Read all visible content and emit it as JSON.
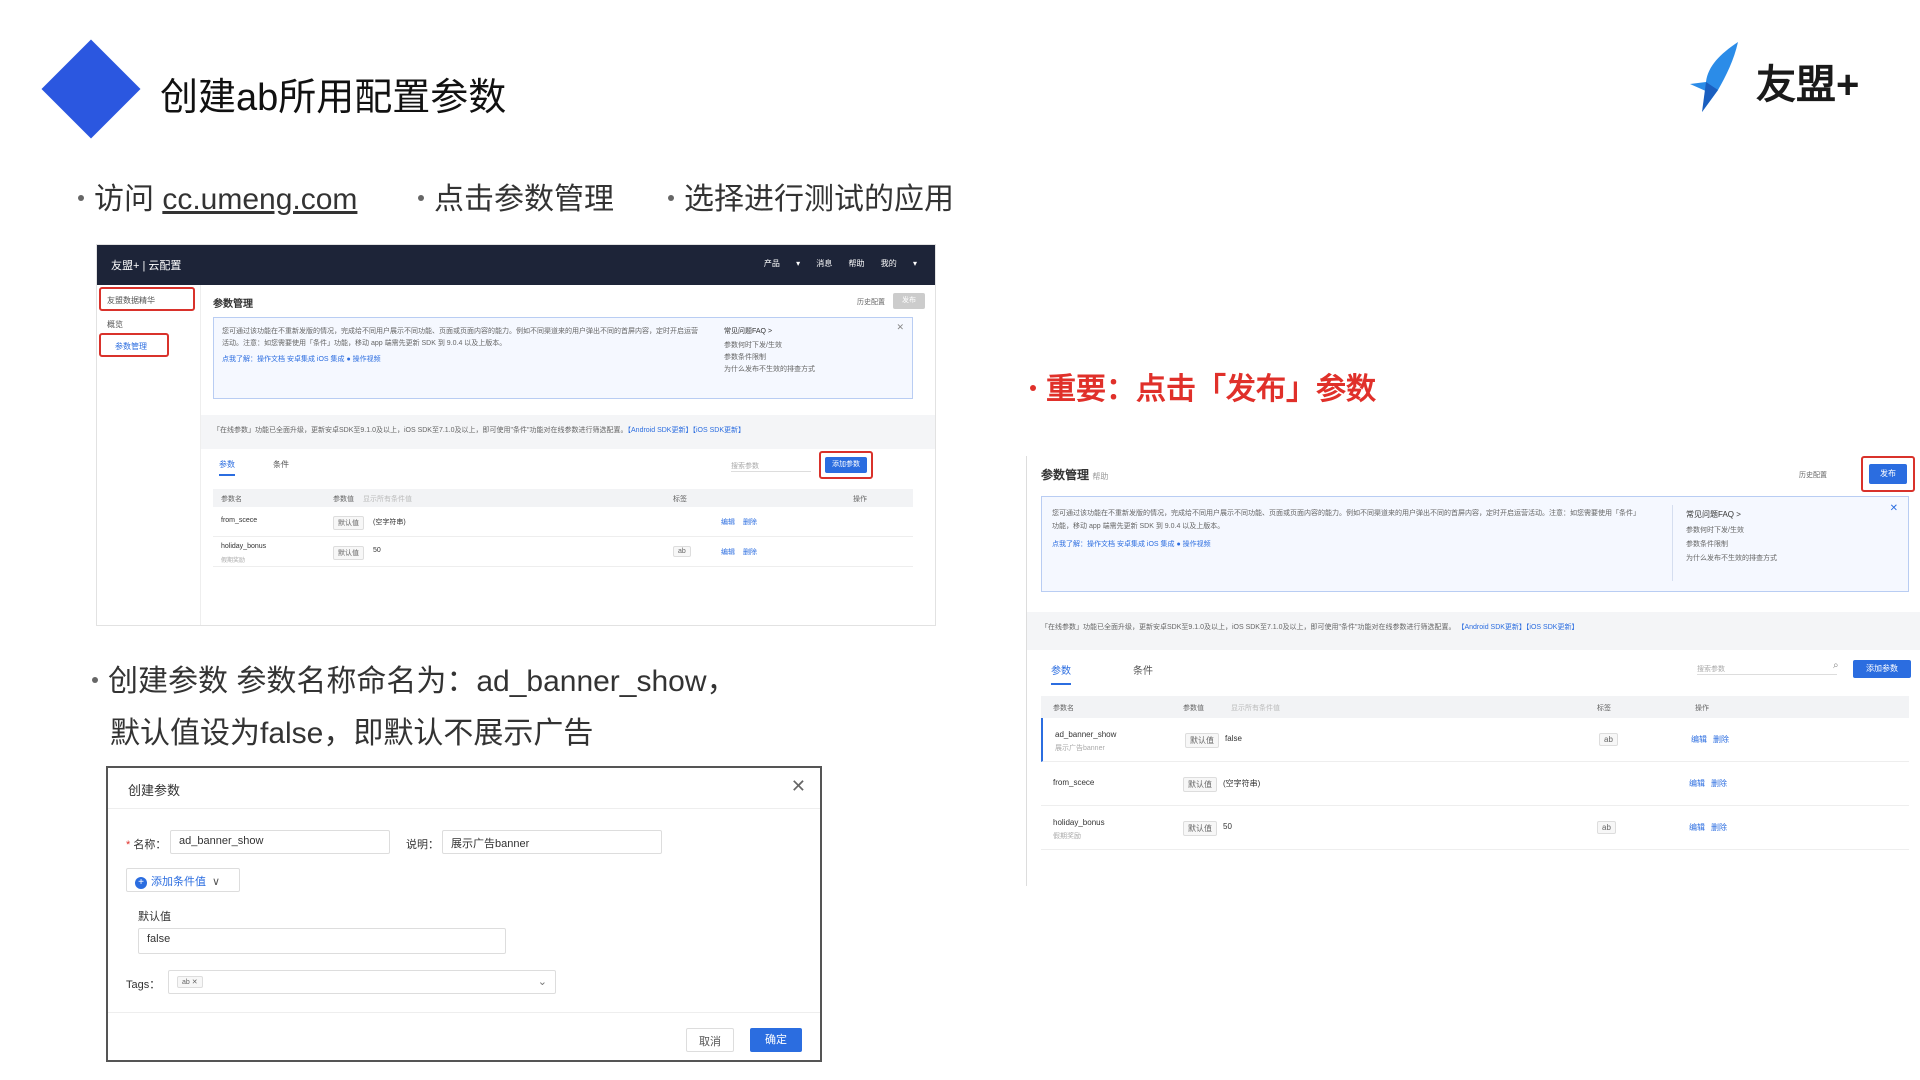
{
  "slide": {
    "title": "创建ab所用配置参数",
    "logo_text": "友盟+",
    "step1_prefix": "访问 ",
    "step1_link": "cc.umeng.com",
    "step2": "点击参数管理",
    "step3": "选择进行测试的应用",
    "important": "重要：点击「发布」参数",
    "create_line1": "创建参数 参数名称命名为：ad_banner_show，",
    "create_line2": "默认值设为false，即默认不展示广告"
  },
  "colors": {
    "accent": "#2b57e0",
    "highlight": "#d9322b",
    "important": "#e0302a",
    "topbar": "#1d2438"
  },
  "console": {
    "brand": "友盟+ | 云配置",
    "nav": "产品 ▾  消息  帮助  我的 ▾",
    "app_selector": "友盟数据精华",
    "sidebar_overview": "概览",
    "sidebar_params": "参数管理",
    "page_title": "参数管理",
    "page_sub": "帮助",
    "history": "历史配置",
    "publish": "发布",
    "info_text1": "您可通过该功能在不重新发版的情况，完成给不同用户展示不同功能、页面或页面内容的能力。例如不同渠道来的用户弹出不同的首屏内容，定时开启",
    "info_text2": "运营活动。注意：如您需要使用「条件」功能，移动 app 端需先更新 SDK 到 9.0.4 以及上版本。",
    "info_links": "点我了解：操作文档  安卓集成  iOS 集成  ● 操作视频",
    "faq_title": "常见问题FAQ >",
    "faq_items": [
      "参数何时下发/生效",
      "参数条件限制",
      "为什么发布不生效的排查方式"
    ],
    "upgrade_note": "「在线参数」功能已全面升级，更新安卓SDK至9.1.0及以上，iOS SDK至7.1.0及以上，即可使用\"条件\"功能对在线参数进行筛选配置。",
    "upgrade_links": "【Android SDK更新】【iOS SDK更新】",
    "tab_params": "参数",
    "tab_conditions": "条件",
    "search_placeholder": "搜索参数",
    "add_param": "添加参数",
    "col_name": "参数名",
    "col_value": "参数值",
    "col_show_all": "显示所有条件值",
    "col_tag": "标签",
    "col_action": "操作",
    "default_label": "默认值",
    "edit": "编辑",
    "delete": "删除",
    "rows1": [
      {
        "name": "from_scece",
        "desc": "",
        "value": "(空字符串)",
        "tag": ""
      },
      {
        "name": "holiday_bonus",
        "desc": "假期奖励",
        "value": "50",
        "tag": "ab"
      }
    ],
    "rows2": [
      {
        "name": "ad_banner_show",
        "desc": "展示广告banner",
        "value": "false",
        "tag": "ab"
      },
      {
        "name": "from_scece",
        "desc": "",
        "value": "(空字符串)",
        "tag": ""
      },
      {
        "name": "holiday_bonus",
        "desc": "假期奖励",
        "value": "50",
        "tag": "ab"
      }
    ]
  },
  "dialog": {
    "title": "创建参数",
    "name_label": "名称：",
    "name_value": "ad_banner_show",
    "desc_label": "说明：",
    "desc_value": "展示广告banner",
    "add_condition": "添加条件值",
    "default_label": "默认值",
    "default_value": "false",
    "tags_label": "Tags：",
    "tag_value": "ab",
    "cancel": "取消",
    "confirm": "确定"
  }
}
